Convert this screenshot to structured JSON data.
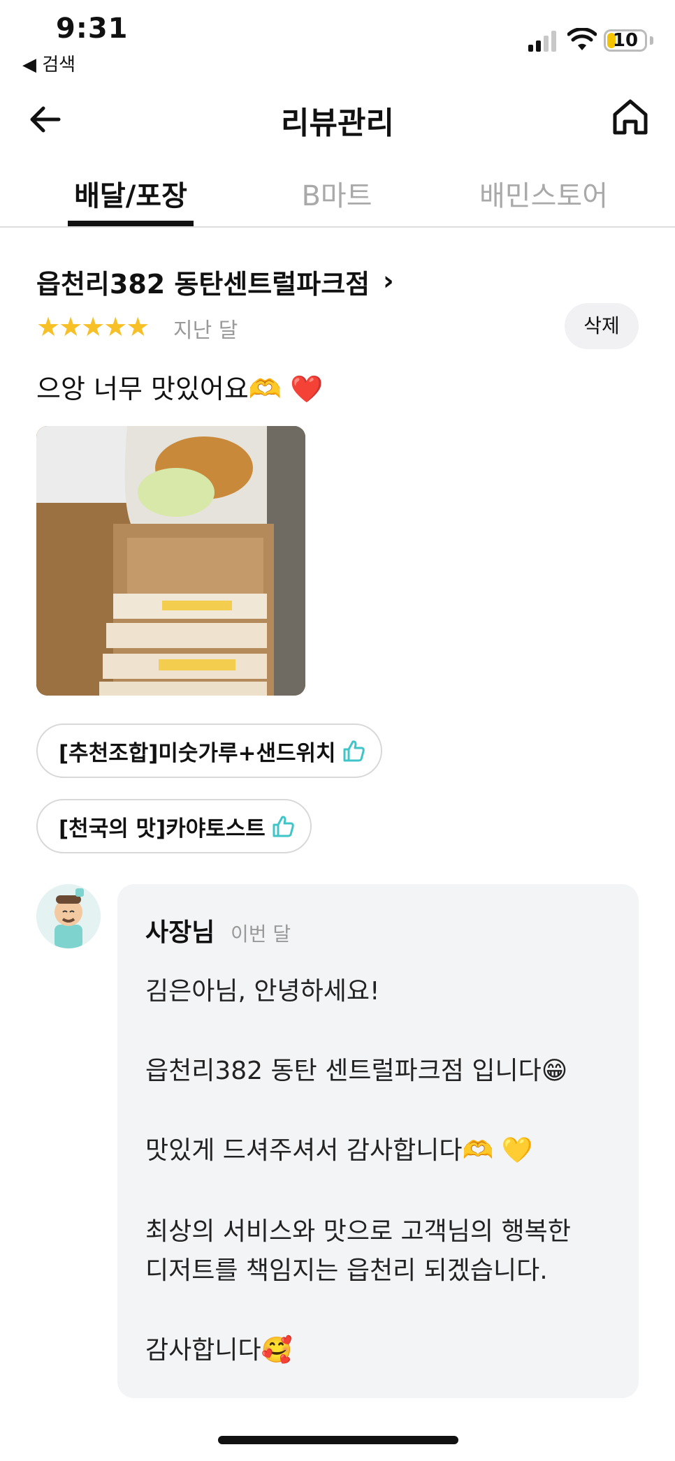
{
  "status_bar": {
    "time": "9:31",
    "back_app": "◀ 검색",
    "battery": "10"
  },
  "header": {
    "title": "리뷰관리"
  },
  "tabs": [
    {
      "label": "배달/포장",
      "active": true
    },
    {
      "label": "B마트",
      "active": false
    },
    {
      "label": "배민스토어",
      "active": false
    }
  ],
  "review": {
    "store_name": "읍천리382 동탄센트럴파크점",
    "rating": 5,
    "stars": "★★★★★",
    "date": "지난 달",
    "delete_label": "삭제",
    "text": "으앙 너무 맛있어요🫶 ❤️",
    "menu_items": [
      {
        "label": "[추천조합]미숫가루+샌드위치"
      },
      {
        "label": "[천국의 맛]카야토스트"
      }
    ]
  },
  "owner_reply": {
    "name": "사장님",
    "date": "이번 달",
    "lines": [
      "김은아님, 안녕하세요!",
      "읍천리382 동탄 센트럴파크점 입니다😁",
      "맛있게 드셔주셔서 감사합니다🫶 💛",
      "최상의 서비스와 맛으로 고객님의 행복한",
      "디저트를 책임지는 읍천리 되겠습니다.",
      "감사합니다🥰"
    ]
  },
  "colors": {
    "star": "#f6c026",
    "thumb_accent": "#3fc4c7",
    "bubble_bg": "#f3f4f6"
  }
}
